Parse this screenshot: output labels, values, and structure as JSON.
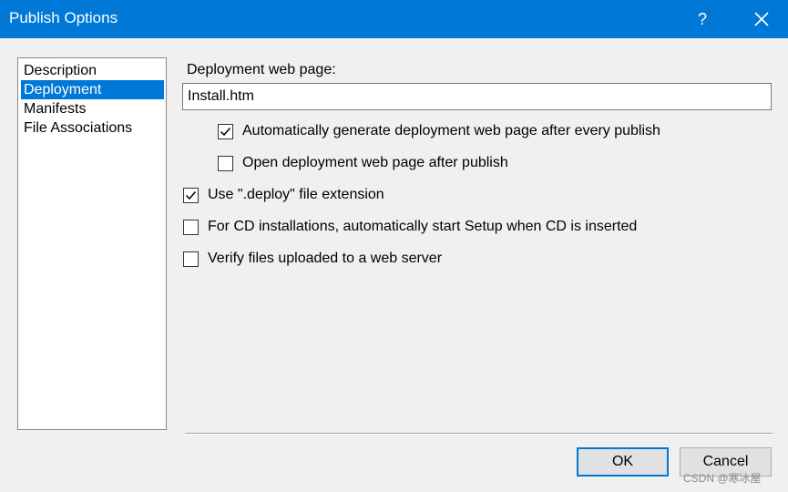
{
  "window": {
    "title": "Publish Options",
    "help_label": "?"
  },
  "sidebar": {
    "items": [
      {
        "label": "Description",
        "selected": false
      },
      {
        "label": "Deployment",
        "selected": true
      },
      {
        "label": "Manifests",
        "selected": false
      },
      {
        "label": "File Associations",
        "selected": false
      }
    ]
  },
  "deployment": {
    "web_page_label": "Deployment web page:",
    "web_page_value": "Install.htm",
    "options": [
      {
        "label": "Automatically generate deployment web page after every publish",
        "checked": true
      },
      {
        "label": "Open deployment web page after publish",
        "checked": false
      },
      {
        "label": "Use \".deploy\" file extension",
        "checked": true
      },
      {
        "label": "For CD installations, automatically start Setup when CD is inserted",
        "checked": false
      },
      {
        "label": "Verify files uploaded to a web server",
        "checked": false
      }
    ]
  },
  "buttons": {
    "ok_label": "OK",
    "cancel_label": "Cancel"
  },
  "watermark": "CSDN @寒冰屋",
  "colors": {
    "accent": "#0078d7",
    "background": "#f0f0f0"
  }
}
